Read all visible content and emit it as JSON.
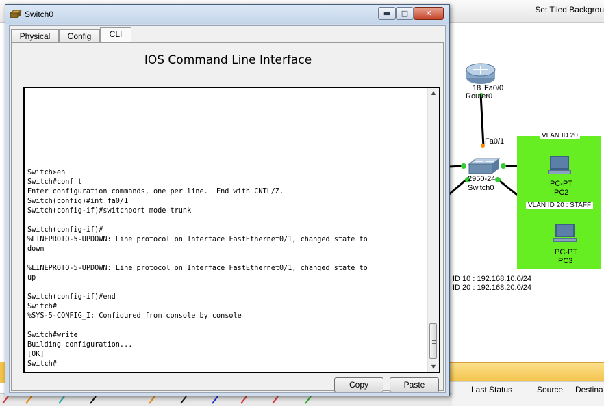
{
  "background": {
    "toolbar_text": "Set Tiled Backgrou",
    "status_columns": [
      "Last Status",
      "Source",
      "Destina"
    ],
    "topology": {
      "router_number": "18",
      "router_port": "Fa0/0",
      "router_name": "Router0",
      "switch_port": "Fa0/1",
      "switch_model": "2950-24",
      "switch_name": "Switch0",
      "pc2_type": "PC-PT",
      "pc2_name": "PC2",
      "pc3_type": "PC-PT",
      "pc3_name": "PC3",
      "vlan_box_label": "VLAN ID 20",
      "vlan_staff_label": "VLAN ID 20 : STAFF",
      "vlan10_note": "ID 10 : 192.168.10.0/24",
      "vlan20_note": "ID 20 : 192.168.20.0/24"
    }
  },
  "window": {
    "title": "Switch0",
    "min_icon": "minimize-icon",
    "max_icon": "maximize-icon",
    "close_icon": "close-icon",
    "tabs": [
      {
        "label": "Physical"
      },
      {
        "label": "Config"
      },
      {
        "label": "CLI"
      }
    ],
    "active_tab": "CLI",
    "heading": "IOS Command Line Interface",
    "terminal_text": "Switch>en\nSwitch#conf t\nEnter configuration commands, one per line.  End with CNTL/Z.\nSwitch(config)#int fa0/1\nSwitch(config-if)#switchport mode trunk\n\nSwitch(config-if)#\n%LINEPROTO-5-UPDOWN: Line protocol on Interface FastEthernet0/1, changed state to\ndown\n\n%LINEPROTO-5-UPDOWN: Line protocol on Interface FastEthernet0/1, changed state to\nup\n\nSwitch(config-if)#end\nSwitch#\n%SYS-5-CONFIG_I: Configured from console by console\n\nSwitch#write\nBuilding configuration...\n[OK]\nSwitch#",
    "copy_label": "Copy",
    "paste_label": "Paste"
  },
  "colors": {
    "vlan_area": "#66ee22",
    "title_bar": "#c4d5ea",
    "close_button": "#c7442a"
  }
}
